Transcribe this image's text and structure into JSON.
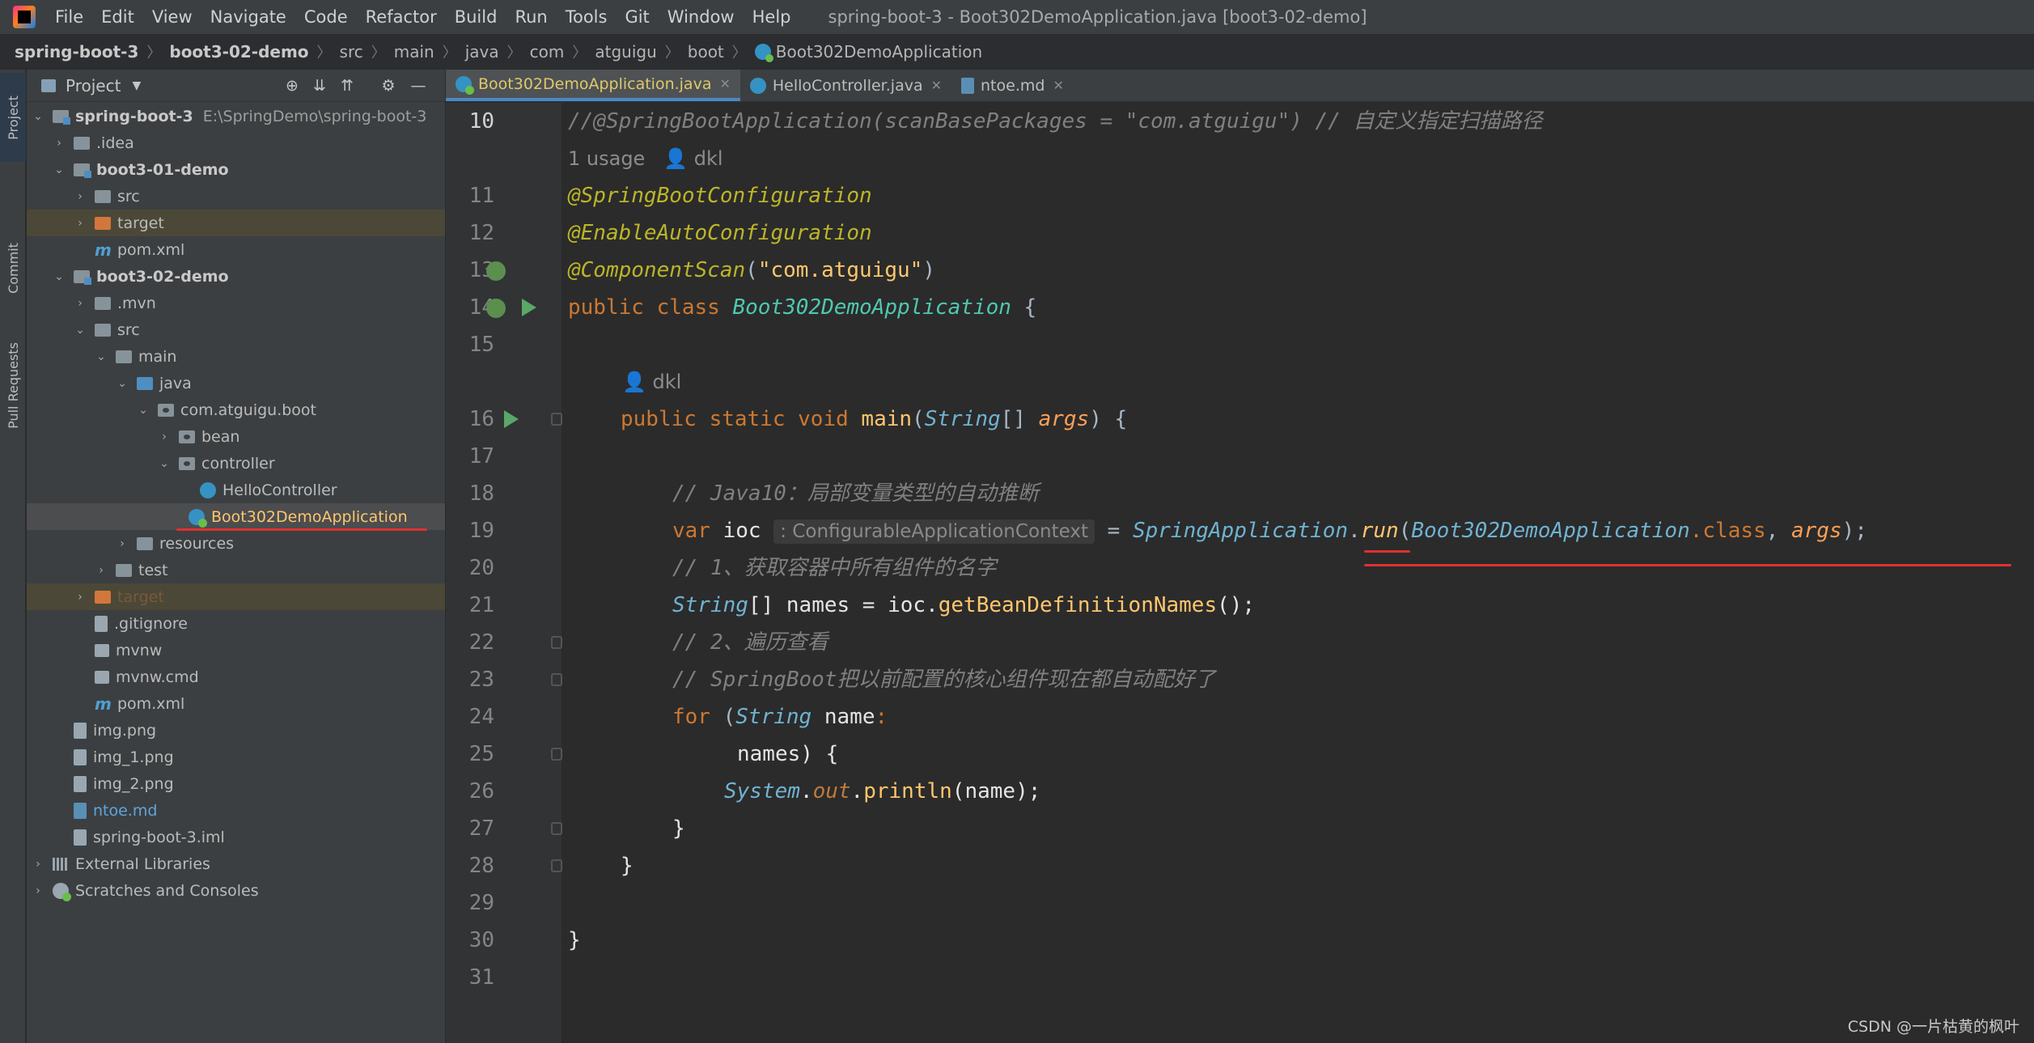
{
  "menubar": {
    "items": [
      "File",
      "Edit",
      "View",
      "Navigate",
      "Code",
      "Refactor",
      "Build",
      "Run",
      "Tools",
      "Git",
      "Window",
      "Help"
    ],
    "title": "spring-boot-3 - Boot302DemoApplication.java [boot3-02-demo]"
  },
  "breadcrumb": [
    "spring-boot-3",
    "boot3-02-demo",
    "src",
    "main",
    "java",
    "com",
    "atguigu",
    "boot",
    "Boot302DemoApplication"
  ],
  "sidestrip": {
    "project": "Project",
    "commit": "Commit",
    "pull_requests": "Pull Requests"
  },
  "project_panel": {
    "title": "Project",
    "tree": [
      {
        "label": "spring-boot-3",
        "path": "E:\\SpringDemo\\spring-boot-3"
      },
      {
        "label": ".idea"
      },
      {
        "label": "boot3-01-demo"
      },
      {
        "label": "src"
      },
      {
        "label": "target"
      },
      {
        "label": "pom.xml"
      },
      {
        "label": "boot3-02-demo"
      },
      {
        "label": ".mvn"
      },
      {
        "label": "src"
      },
      {
        "label": "main"
      },
      {
        "label": "java"
      },
      {
        "label": "com.atguigu.boot"
      },
      {
        "label": "bean"
      },
      {
        "label": "controller"
      },
      {
        "label": "HelloController"
      },
      {
        "label": "Boot302DemoApplication"
      },
      {
        "label": "resources"
      },
      {
        "label": "test"
      },
      {
        "label": "target"
      },
      {
        "label": ".gitignore"
      },
      {
        "label": "mvnw"
      },
      {
        "label": "mvnw.cmd"
      },
      {
        "label": "pom.xml"
      },
      {
        "label": "img.png"
      },
      {
        "label": "img_1.png"
      },
      {
        "label": "img_2.png"
      },
      {
        "label": "ntoe.md"
      },
      {
        "label": "spring-boot-3.iml"
      },
      {
        "label": "External Libraries"
      },
      {
        "label": "Scratches and Consoles"
      }
    ]
  },
  "editor_tabs": [
    {
      "label": "Boot302DemoApplication.java",
      "active": true
    },
    {
      "label": "HelloController.java",
      "active": false
    },
    {
      "label": "ntoe.md",
      "active": false
    }
  ],
  "code": {
    "line_numbers": [
      "10",
      "11",
      "12",
      "13",
      "14",
      "15",
      "16",
      "17",
      "18",
      "19",
      "20",
      "21",
      "22",
      "23",
      "24",
      "25",
      "26",
      "27",
      "28",
      "29",
      "30",
      "31"
    ],
    "l10_comment": "//@SpringBootApplication(scanBasePackages = \"com.atguigu\") // 自定义指定扫描路径",
    "usage_hint": "1 usage",
    "author_hint": "dkl",
    "l11": "@SpringBootConfiguration",
    "l12": "@EnableAutoConfiguration",
    "l13_annot": "@ComponentScan",
    "l13_str": "\"com.atguigu\"",
    "l14_kw": "public class ",
    "l14_class": "Boot302DemoApplication",
    "l16_kw": "public static void ",
    "l16_method": "main",
    "l16_type": "String",
    "l16_param": "args",
    "l18": "// Java10：局部变量类型的自动推断",
    "l19_var": "var ",
    "l19_name": "ioc",
    "l19_hint": ": ConfigurableApplicationContext",
    "l19_cls": "SpringApplication",
    "l19_run": "run",
    "l19_arg_cls": "Boot302DemoApplication",
    "l19_class_kw": ".class",
    "l19_args": "args",
    "l20": "// 1、获取容器中所有组件的名字",
    "l21_type": "String",
    "l21_rest": "[] names = ioc.",
    "l21_method": "getBeanDefinitionNames",
    "l22": "// 2、遍历查看",
    "l23": "// SpringBoot把以前配置的核心组件现在都自动配好了",
    "l24_kw": "for ",
    "l24_type": "String",
    "l24_name": " name",
    "l25": "names) {",
    "l26_cls": "System",
    "l26_field": "out",
    "l26_method": "println",
    "l26_arg": "name"
  },
  "watermark": "CSDN @一片枯黄的枫叶"
}
